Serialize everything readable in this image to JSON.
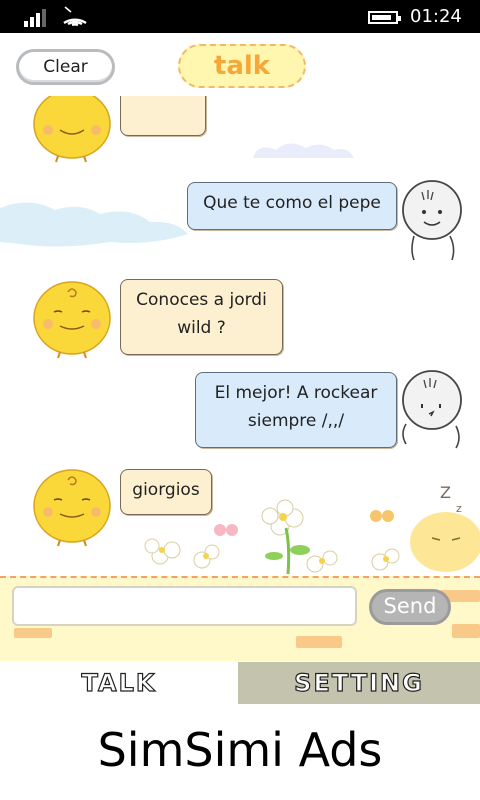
{
  "status_bar": {
    "time": "01:24",
    "signal_icon": "signal-bars-icon",
    "wifi_icon": "wifi-icon",
    "battery_icon": "battery-icon"
  },
  "header": {
    "clear_label": "Clear",
    "logo_text": "talk"
  },
  "messages": [
    {
      "side": "left",
      "text": ""
    },
    {
      "side": "right",
      "text": "Que te como el pepe"
    },
    {
      "side": "left",
      "text": "Conoces a jordi wild ?"
    },
    {
      "side": "right",
      "text": "El mejor! A rockear siempre /,,/"
    },
    {
      "side": "left",
      "text": "giorgios"
    }
  ],
  "composer": {
    "input_value": "",
    "input_placeholder": "",
    "send_label": "Send"
  },
  "tabs": {
    "talk_label": "TALK",
    "setting_label": "SETTING"
  },
  "ads": {
    "text": "SimSimi Ads"
  },
  "colors": {
    "left_bubble": "#fdf0d0",
    "right_bubble": "#d9ebfb",
    "input_bar": "#fff8c8",
    "setting_tab": "#c4c3ad"
  }
}
